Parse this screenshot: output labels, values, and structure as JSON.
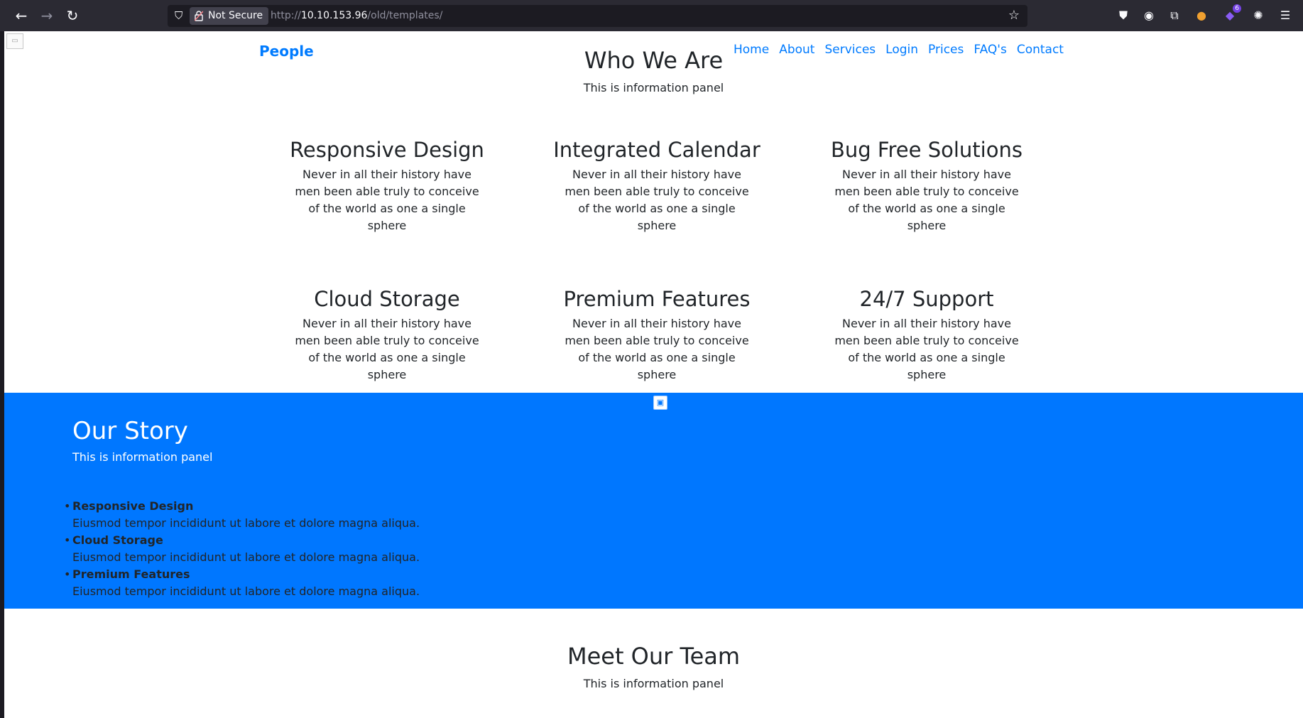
{
  "browser": {
    "security_label": "Not Secure",
    "url_scheme": "http://",
    "url_host": "10.10.153.96",
    "url_path": "/old/templates/",
    "extension_badge": "6"
  },
  "nav": {
    "brand": "People",
    "links": [
      "Home",
      "About",
      "Services",
      "Login",
      "Prices",
      "FAQ's",
      "Contact"
    ]
  },
  "who_we_are": {
    "title": "Who We Are",
    "subtitle": "This is information panel",
    "features": [
      {
        "title": "Responsive Design",
        "text": "Never in all their history have men been able truly to conceive of the world as one a single sphere"
      },
      {
        "title": "Integrated Calendar",
        "text": "Never in all their history have men been able truly to conceive of the world as one a single sphere"
      },
      {
        "title": "Bug Free Solutions",
        "text": "Never in all their history have men been able truly to conceive of the world as one a single sphere"
      },
      {
        "title": "Cloud Storage",
        "text": "Never in all their history have men been able truly to conceive of the world as one a single sphere"
      },
      {
        "title": "Premium Features",
        "text": "Never in all their history have men been able truly to conceive of the world as one a single sphere"
      },
      {
        "title": "24/7 Support",
        "text": "Never in all their history have men been able truly to conceive of the world as one a single sphere"
      }
    ]
  },
  "our_story": {
    "title": "Our Story",
    "subtitle": "This is information panel",
    "items": [
      {
        "title": "Responsive Design",
        "text": "Eiusmod tempor incididunt ut labore et dolore magna aliqua."
      },
      {
        "title": "Cloud Storage",
        "text": "Eiusmod tempor incididunt ut labore et dolore magna aliqua."
      },
      {
        "title": "Premium Features",
        "text": "Eiusmod tempor incididunt ut labore et dolore magna aliqua."
      }
    ]
  },
  "team": {
    "title": "Meet Our Team",
    "subtitle": "This is information panel"
  },
  "colors": {
    "accent": "#007bff",
    "story_bg": "#0077ff",
    "chrome_bg": "#2b2a33"
  }
}
